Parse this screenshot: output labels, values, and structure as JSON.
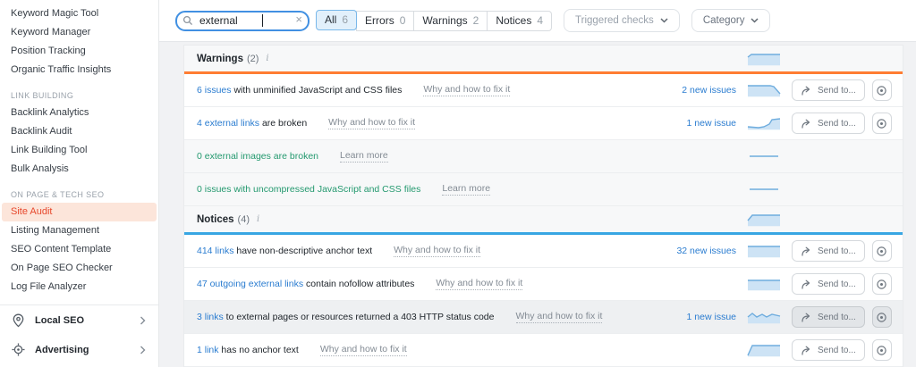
{
  "sidebar": {
    "items_top": [
      {
        "label": "Keyword Magic Tool"
      },
      {
        "label": "Keyword Manager"
      },
      {
        "label": "Position Tracking"
      },
      {
        "label": "Organic Traffic Insights"
      }
    ],
    "section_link_building": "LINK BUILDING",
    "items_link_building": [
      {
        "label": "Backlink Analytics"
      },
      {
        "label": "Backlink Audit"
      },
      {
        "label": "Link Building Tool"
      },
      {
        "label": "Bulk Analysis"
      }
    ],
    "section_onpage": "ON PAGE & TECH SEO",
    "items_onpage": [
      {
        "label": "Site Audit"
      },
      {
        "label": "Listing Management"
      },
      {
        "label": "SEO Content Template"
      },
      {
        "label": "On Page SEO Checker"
      },
      {
        "label": "Log File Analyzer"
      }
    ],
    "footer": [
      {
        "label": "Local SEO",
        "icon": "location-pin-icon"
      },
      {
        "label": "Advertising",
        "icon": "target-icon"
      }
    ]
  },
  "topbar": {
    "search": {
      "value": "external",
      "clear_label": "×"
    },
    "tabs": [
      {
        "label": "All",
        "count": "6",
        "selected": true
      },
      {
        "label": "Errors",
        "count": "0",
        "selected": false
      },
      {
        "label": "Warnings",
        "count": "2",
        "selected": false
      },
      {
        "label": "Notices",
        "count": "4",
        "selected": false
      }
    ],
    "dropdowns": [
      {
        "label": "Triggered checks"
      },
      {
        "label": "Category"
      }
    ]
  },
  "colors": {
    "warnings_accent": "#ff7d33",
    "notices_accent": "#38a6e3",
    "link_blue": "#2a7cd0",
    "ok_green": "#24996f",
    "spark_stroke": "#6fadde",
    "spark_fill": "#cde3f5"
  },
  "sections": [
    {
      "title": "Warnings",
      "count": "(2)",
      "info_icon": "i",
      "header_spark": {
        "t": "area",
        "p": [
          [
            1,
            6
          ],
          [
            5,
            3
          ],
          [
            37,
            3
          ]
        ]
      },
      "rows": [
        {
          "link": "6 issues",
          "text": " with unminified JavaScript and CSS files",
          "action": "Why and how to fix it",
          "new_issues": "2 new issues",
          "send_label": "Send to...",
          "spark": {
            "t": "area",
            "p": [
              [
                1,
                3
              ],
              [
                26,
                3
              ],
              [
                30,
                4
              ],
              [
                37,
                12
              ]
            ]
          }
        },
        {
          "link": "4 external links",
          "text": " are broken",
          "action": "Why and how to fix it",
          "new_issues": "1 new issue",
          "send_label": "Send to...",
          "spark": {
            "t": "area",
            "p": [
              [
                1,
                12
              ],
              [
                13,
                13
              ],
              [
                19,
                12
              ],
              [
                25,
                9
              ],
              [
                28,
                4
              ],
              [
                37,
                3
              ]
            ]
          }
        },
        {
          "ok_text": "0 external images are broken",
          "action": "Learn more",
          "spark": {
            "t": "line",
            "p": [
              [
                3,
                8
              ],
              [
                35,
                8
              ]
            ]
          }
        },
        {
          "ok_text": "0 issues with uncompressed JavaScript and CSS files",
          "action": "Learn more",
          "spark": {
            "t": "line",
            "p": [
              [
                3,
                8
              ],
              [
                35,
                8
              ]
            ]
          }
        }
      ]
    },
    {
      "title": "Notices",
      "count": "(4)",
      "info_icon": "i",
      "header_spark": {
        "t": "area",
        "p": [
          [
            1,
            9
          ],
          [
            6,
            3
          ],
          [
            37,
            3
          ]
        ]
      },
      "rows": [
        {
          "link": "414 links",
          "text": " have non-descriptive anchor text",
          "action": "Why and how to fix it",
          "new_issues": "32 new issues",
          "send_label": "Send to...",
          "spark": {
            "t": "area",
            "p": [
              [
                1,
                3
              ],
              [
                37,
                3
              ]
            ]
          }
        },
        {
          "link": "47 outgoing external links",
          "text": " contain nofollow attributes",
          "action": "Why and how to fix it",
          "new_issues": "",
          "send_label": "Send to...",
          "spark": {
            "t": "area",
            "p": [
              [
                1,
                4
              ],
              [
                37,
                4
              ]
            ]
          }
        },
        {
          "link": "3 links",
          "text": " to external pages or resources returned a 403 HTTP status code",
          "action": "Why and how to fix it",
          "new_issues": "1 new issue",
          "send_label": "Send to...",
          "highlighted": true,
          "spark": {
            "t": "area",
            "p": [
              [
                1,
                8
              ],
              [
                6,
                4
              ],
              [
                11,
                8
              ],
              [
                17,
                5
              ],
              [
                22,
                8
              ],
              [
                28,
                5
              ],
              [
                37,
                7
              ]
            ]
          }
        },
        {
          "link": "1 link",
          "text": " has no anchor text",
          "action": "Why and how to fix it",
          "new_issues": "",
          "send_label": "Send to...",
          "spark": {
            "t": "area",
            "p": [
              [
                1,
                14
              ],
              [
                6,
                3
              ],
              [
                37,
                3
              ]
            ]
          }
        }
      ]
    }
  ]
}
